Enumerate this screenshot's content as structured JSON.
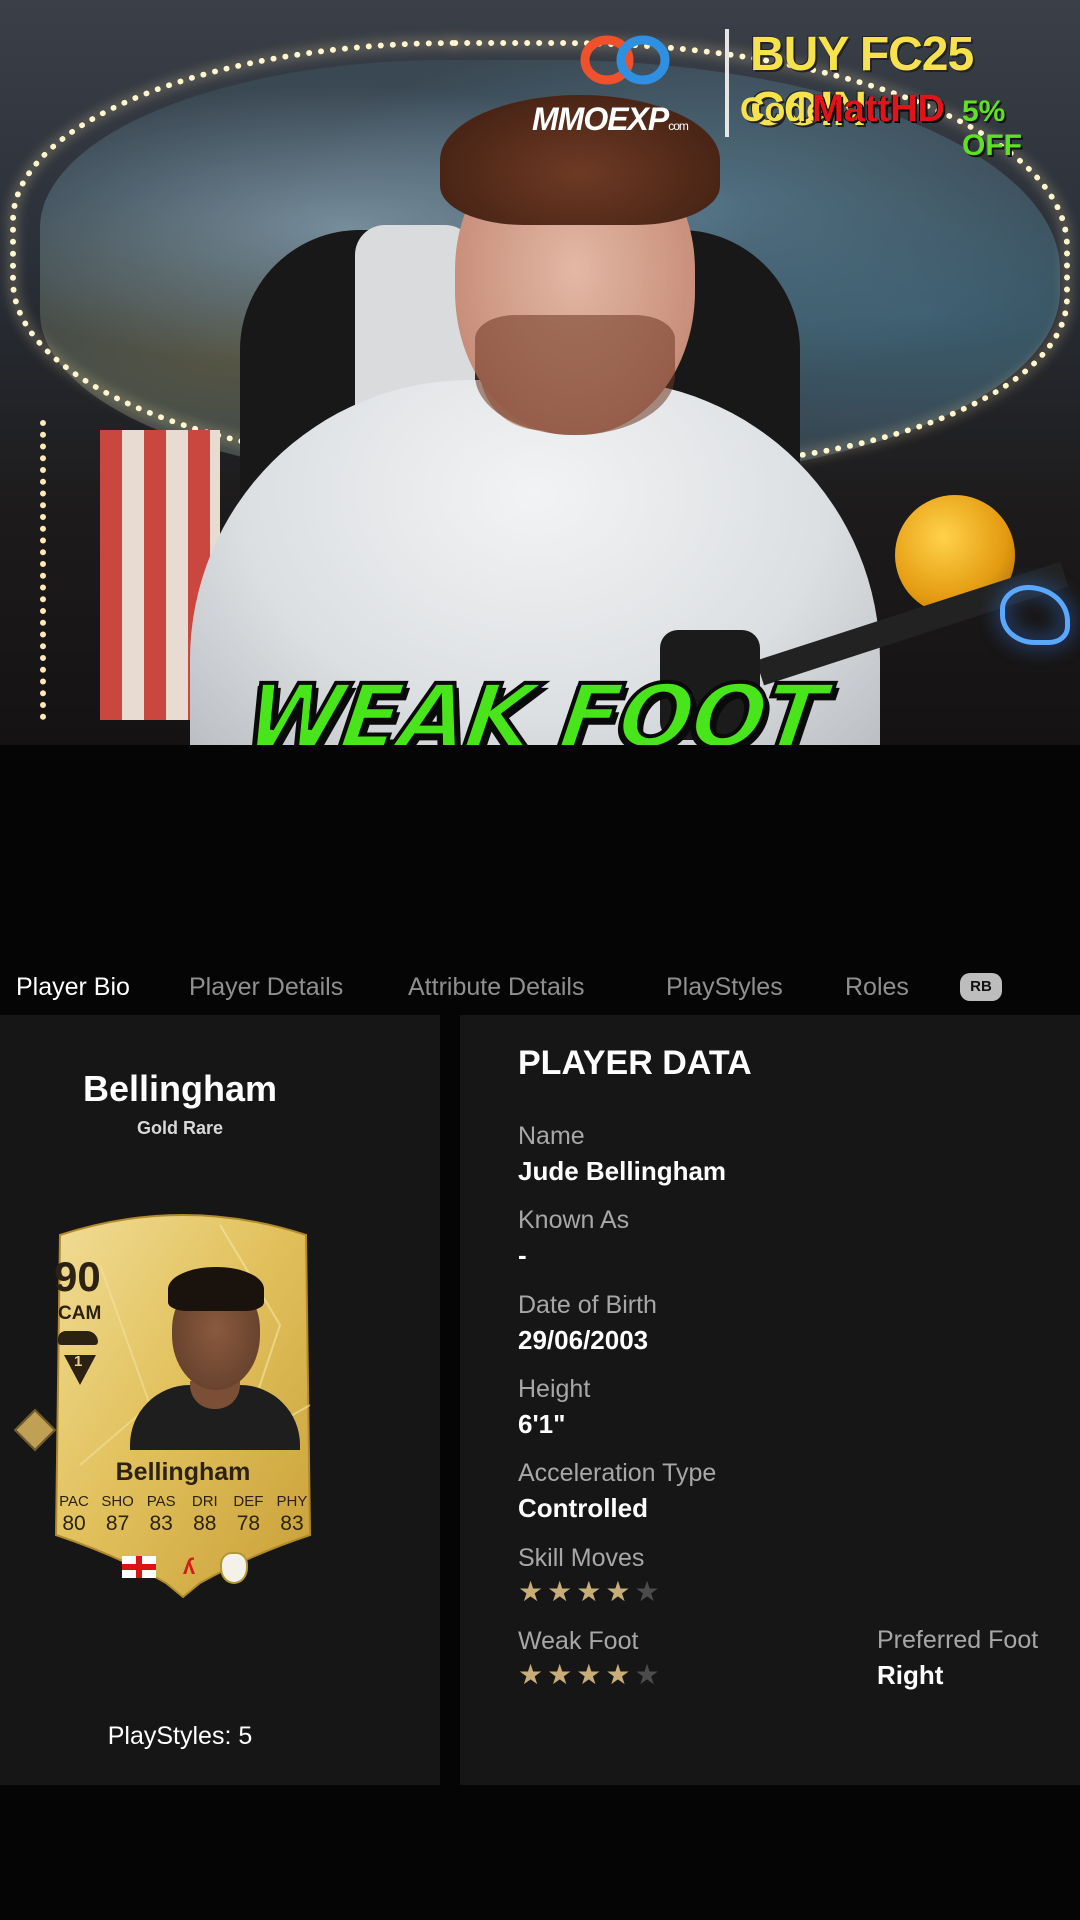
{
  "ad": {
    "brand": "MMOEXP",
    "brand_suffix": "com",
    "title": "BUY FC25 COIN",
    "code_label": "Code",
    "code": "MattHD",
    "discount": "5% OFF"
  },
  "caption": "WEAK FOOT",
  "tabs": [
    {
      "label": "Player Bio",
      "active": true
    },
    {
      "label": "Player Details",
      "active": false
    },
    {
      "label": "Attribute Details",
      "active": false
    },
    {
      "label": "PlayStyles",
      "active": false
    },
    {
      "label": "Roles",
      "active": false
    }
  ],
  "rb_label": "RB",
  "card": {
    "name": "Bellingham",
    "rarity": "Gold Rare",
    "rating": "90",
    "position": "CAM",
    "evolution_level": "1",
    "player_name": "Bellingham",
    "stats": [
      {
        "label": "PAC",
        "value": "80"
      },
      {
        "label": "SHO",
        "value": "87"
      },
      {
        "label": "PAS",
        "value": "83"
      },
      {
        "label": "DRI",
        "value": "88"
      },
      {
        "label": "DEF",
        "value": "78"
      },
      {
        "label": "PHY",
        "value": "83"
      }
    ],
    "card_color": "#e2c25e",
    "league_mark": "⁄"
  },
  "playstyles_count": "PlayStyles: 5",
  "player_data": {
    "title": "PLAYER DATA",
    "name_label": "Name",
    "name_value": "Jude Bellingham",
    "known_as_label": "Known As",
    "known_as_value": "-",
    "dob_label": "Date of Birth",
    "dob_value": "29/06/2003",
    "height_label": "Height",
    "height_value": "6'1\"",
    "acceleration_label": "Acceleration Type",
    "acceleration_value": "Controlled",
    "skill_moves_label": "Skill Moves",
    "skill_moves_rating": 4,
    "skill_moves_max": 5,
    "weak_foot_label": "Weak Foot",
    "weak_foot_rating": 4,
    "weak_foot_max": 5,
    "preferred_foot_label": "Preferred Foot",
    "preferred_foot_value": "Right"
  },
  "colors": {
    "accent_star": "#c7ad78",
    "caption_green": "#48e51a",
    "panel_bg": "#161616"
  }
}
